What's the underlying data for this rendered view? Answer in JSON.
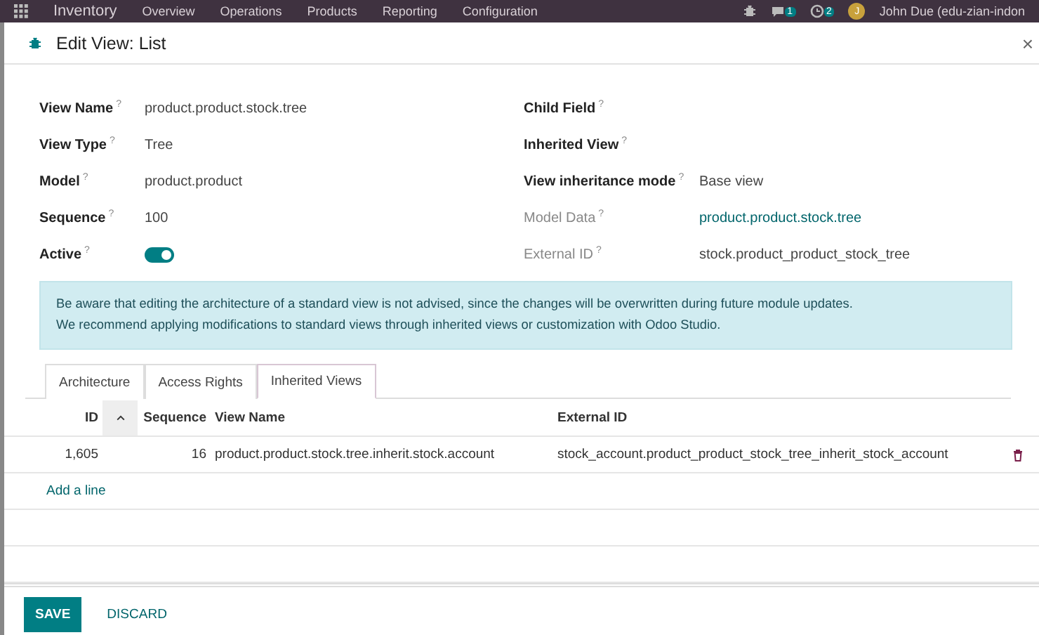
{
  "navbar": {
    "app": "Inventory",
    "menu": [
      "Overview",
      "Operations",
      "Products",
      "Reporting",
      "Configuration"
    ],
    "badges": [
      {
        "kind": "chat",
        "count": "1"
      },
      {
        "kind": "clock",
        "count": "2"
      }
    ],
    "avatar_letter": "J",
    "user": "John Due (edu-zian-indon"
  },
  "dialog": {
    "title": "Edit View: List",
    "close": "×"
  },
  "fields_left": [
    {
      "label": "View Name",
      "help": "?",
      "kind": "text",
      "value": "product.product.stock.tree",
      "muted": false
    },
    {
      "label": "View Type",
      "help": "?",
      "kind": "text",
      "value": "Tree",
      "muted": false
    },
    {
      "label": "Model",
      "help": "?",
      "kind": "text",
      "value": "product.product",
      "muted": false
    },
    {
      "label": "Sequence",
      "help": "?",
      "kind": "text",
      "value": "100",
      "muted": false
    },
    {
      "label": "Active",
      "help": "?",
      "kind": "toggle",
      "on": true,
      "muted": false
    }
  ],
  "fields_right": [
    {
      "label": "Child Field",
      "help": "?",
      "kind": "text",
      "muted": false
    },
    {
      "label": "Inherited View",
      "help": "?",
      "kind": "text",
      "muted": false
    },
    {
      "label": "View inheritance mode",
      "help": "?",
      "kind": "text",
      "value": "Base view",
      "muted": false
    },
    {
      "label": "Model Data",
      "help": "?",
      "kind": "link",
      "value": "product.product.stock.tree",
      "muted": true
    },
    {
      "label": "External ID",
      "help": "?",
      "kind": "text",
      "value": "stock.product_product_stock_tree",
      "muted": true
    }
  ],
  "alert": [
    "Be aware that editing the architecture of a standard view is not advised, since the changes will be overwritten during future module updates.",
    "We recommend applying modifications to standard views through inherited views or customization with Odoo Studio."
  ],
  "tabs": [
    {
      "label": "Architecture",
      "selected": false
    },
    {
      "label": "Access Rights",
      "selected": false
    },
    {
      "label": "Inherited Views",
      "selected": true
    }
  ],
  "table": {
    "columns": [
      "ID",
      "Sequence",
      "View Name",
      "External ID"
    ],
    "rows": [
      {
        "id": "1,605",
        "sequence": "16",
        "view_name": "product.product.stock.tree.inherit.stock.account",
        "external_id": "stock_account.product_product_stock_tree_inherit_stock_account"
      }
    ],
    "add_line": "Add a line"
  },
  "buttons": [
    {
      "label": "SAVE",
      "kind": "primary"
    },
    {
      "label": "DISCARD",
      "kind": "link"
    }
  ]
}
